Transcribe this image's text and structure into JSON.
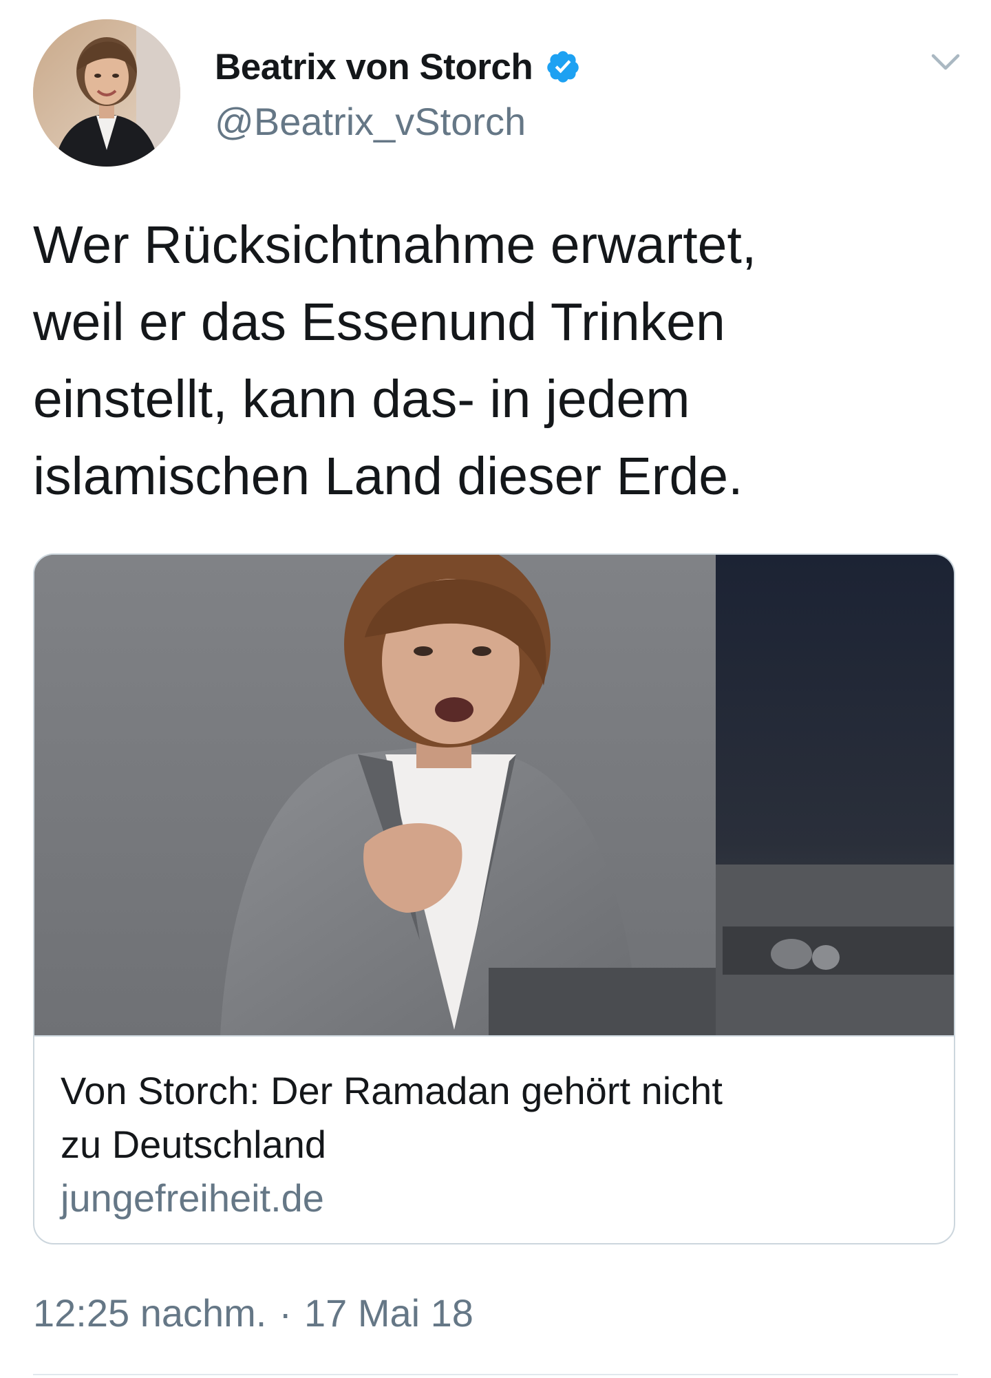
{
  "tweet": {
    "author": {
      "display_name": "Beatrix von Storch",
      "handle": "@Beatrix_vStorch",
      "verified_icon": "verified-badge-icon",
      "avatar": "author-avatar-photo"
    },
    "menu_icon": "chevron-down-icon",
    "text_lines": [
      "Wer Rücksichtnahme erwartet,",
      "weil er das Essenund Trinken",
      "einstellt, kann das- in jedem",
      "islamischen Land dieser Erde."
    ],
    "card": {
      "title_lines": [
        "Von Storch: Der Ramadan gehört nicht",
        "zu Deutschland"
      ],
      "domain": "jungefreiheit.de",
      "image": "speaker-at-lectern-photo"
    },
    "timestamp": {
      "time": "12:25 nachm.",
      "separator": "·",
      "date": "17 Mai 18"
    }
  },
  "colors": {
    "primary_text": "#14171a",
    "secondary_text": "#657786",
    "verified_blue": "#1da1f2",
    "border": "#ccd6dd"
  }
}
